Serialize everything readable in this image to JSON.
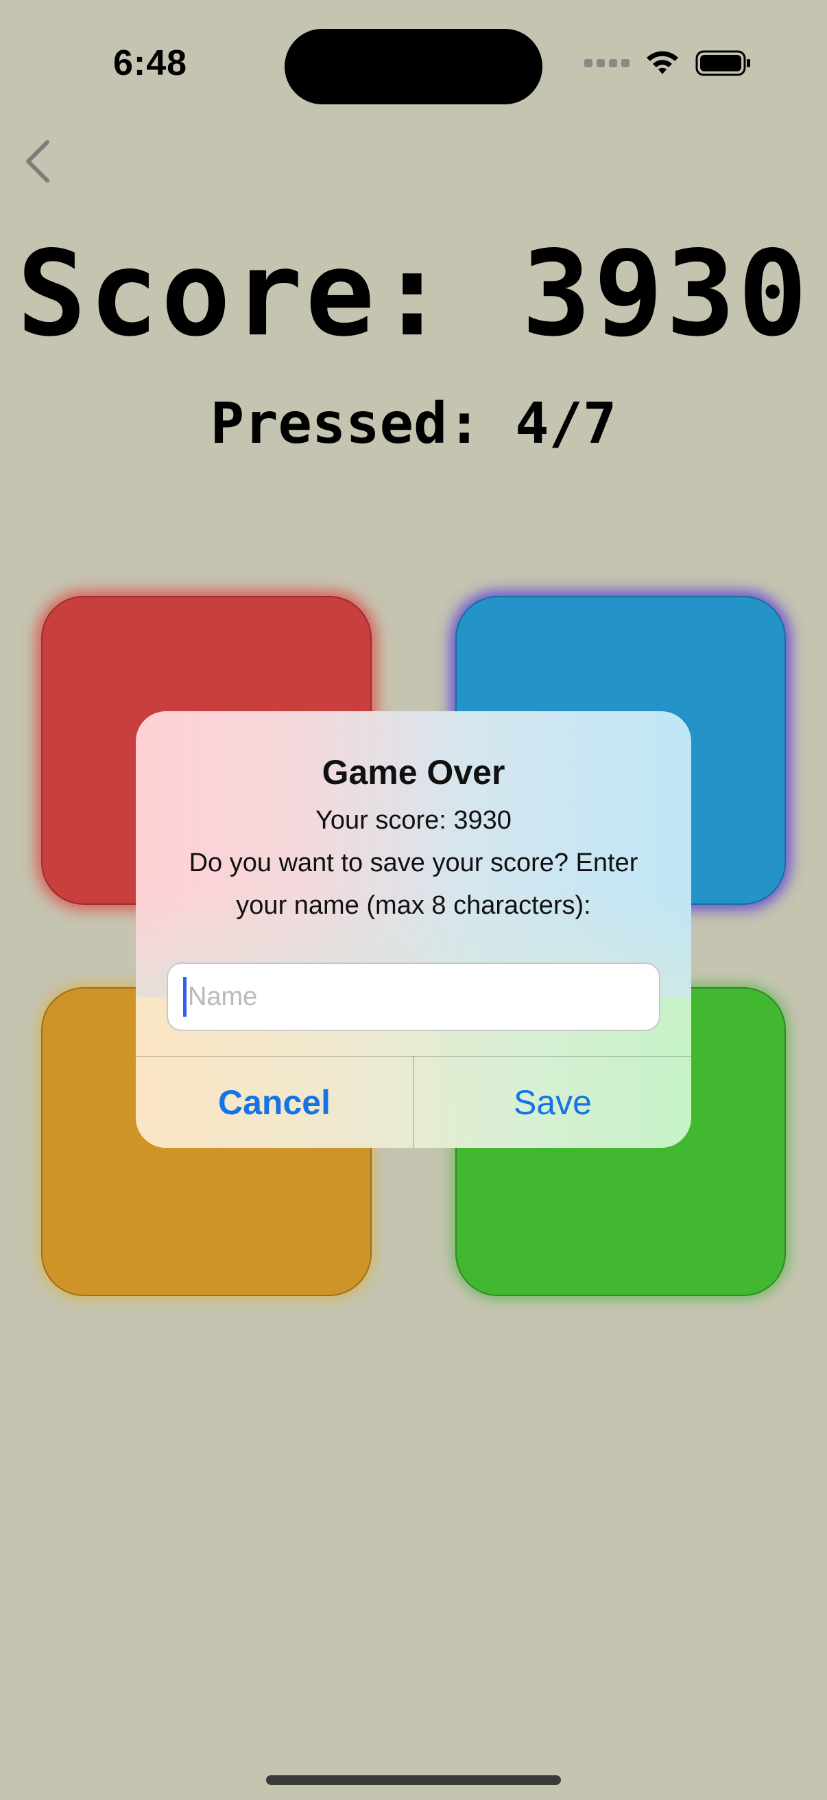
{
  "status_bar": {
    "time": "6:48"
  },
  "navigation": {
    "back_icon": "chevron-left-icon"
  },
  "game": {
    "score_text": "Score: 3930",
    "pressed_text": "Pressed: 4/7",
    "tiles": [
      {
        "color_name": "red",
        "color": "#c83f3d"
      },
      {
        "color_name": "blue",
        "color": "#2493c8"
      },
      {
        "color_name": "yellow",
        "color": "#cf9428"
      },
      {
        "color_name": "green",
        "color": "#41b82f"
      }
    ],
    "background_color": "#c5c4b0"
  },
  "alert": {
    "title": "Game Over",
    "message_line1": "Your score: 3930",
    "message_line2": "Do you want to save your score? Enter your name (max 8 characters):",
    "input": {
      "value": "",
      "placeholder": "Name"
    },
    "cancel_label": "Cancel",
    "save_label": "Save",
    "accent_color": "#1673e6"
  }
}
